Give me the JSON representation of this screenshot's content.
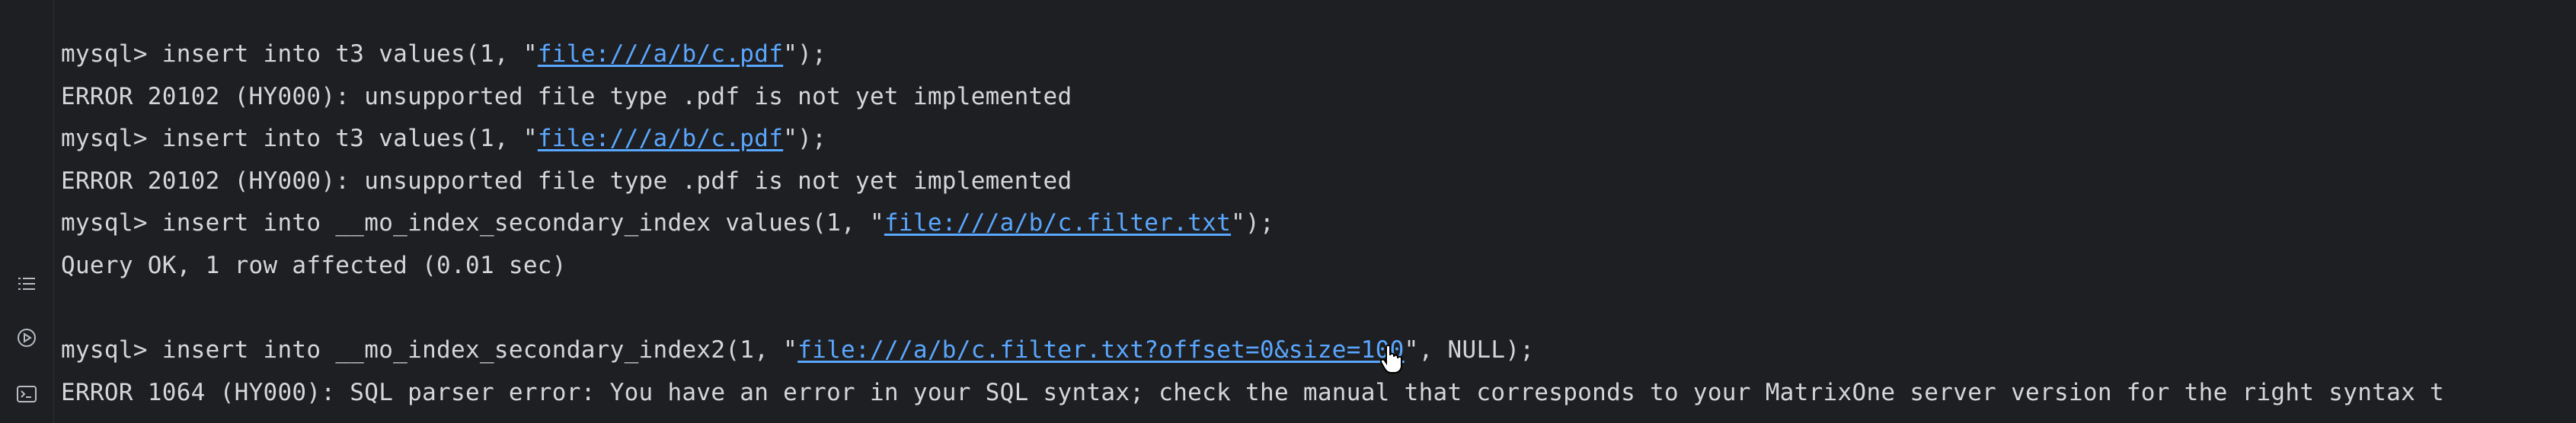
{
  "sidebar": {
    "icons": [
      {
        "name": "list-icon"
      },
      {
        "name": "play-circle-icon"
      },
      {
        "name": "terminal-icon"
      }
    ]
  },
  "lines": [
    {
      "type": "cmd",
      "prompt": "mysql> ",
      "before": "insert into t3 values(1, \"",
      "link": "file:///a/b/c.pdf",
      "after": "\");"
    },
    {
      "type": "out",
      "text": "ERROR 20102 (HY000): unsupported file type .pdf is not yet implemented"
    },
    {
      "type": "cmd",
      "prompt": "mysql> ",
      "before": "insert into t3 values(1, \"",
      "link": "file:///a/b/c.pdf",
      "after": "\");"
    },
    {
      "type": "out",
      "text": "ERROR 20102 (HY000): unsupported file type .pdf is not yet implemented"
    },
    {
      "type": "cmd",
      "prompt": "mysql> ",
      "before": "insert into __mo_index_secondary_index values(1, \"",
      "link": "file:///a/b/c.filter.txt",
      "after": "\");"
    },
    {
      "type": "out",
      "text": "Query OK, 1 row affected (0.01 sec)"
    },
    {
      "type": "out",
      "text": ""
    },
    {
      "type": "cmd",
      "prompt": "mysql> ",
      "before": "insert into __mo_index_secondary_index2(1, \"",
      "link": "file:///a/b/c.filter.txt?offset=0&size=100",
      "after": "\", NULL);"
    },
    {
      "type": "out",
      "text": "ERROR 1064 (HY000): SQL parser error: You have an error in your SQL syntax; check the manual that corresponds to your MatrixOne server version for the right syntax t"
    }
  ],
  "colors": {
    "background": "#1e1f22",
    "text": "#d5d6d9",
    "link": "#5aa7ff"
  }
}
